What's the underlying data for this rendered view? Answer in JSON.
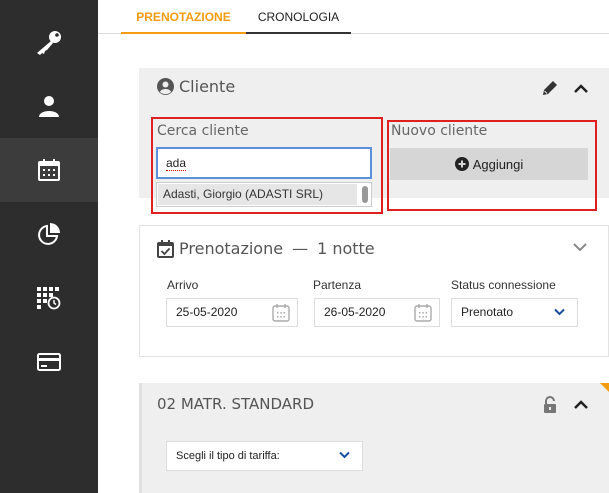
{
  "sidebar": {
    "items": [
      {
        "icon": "key-icon"
      },
      {
        "icon": "user-icon"
      },
      {
        "icon": "calendar-icon",
        "active": true
      },
      {
        "icon": "pie-chart-icon"
      },
      {
        "icon": "calendar-grid-clock-icon"
      },
      {
        "icon": "credit-card-icon"
      }
    ]
  },
  "tabs": [
    {
      "label": "PRENOTAZIONE",
      "active": true
    },
    {
      "label": "CRONOLOGIA",
      "active": false
    }
  ],
  "cliente": {
    "title": "Cliente",
    "search_label": "Cerca cliente",
    "search_value": "ada",
    "suggestion": "Adasti, Giorgio (ADASTI SRL)",
    "new_label": "Nuovo cliente",
    "add_button": "Aggiungi"
  },
  "prenotazione": {
    "title": "Prenotazione",
    "separator": "—",
    "nights": "1 notte",
    "arrivo_label": "Arrivo",
    "arrivo_value": "25-05-2020",
    "partenza_label": "Partenza",
    "partenza_value": "26-05-2020",
    "status_label": "Status connessione",
    "status_value": "Prenotato"
  },
  "room": {
    "title": "02 MATR. STANDARD",
    "tariff_select": "Scegli il tipo di tariffa:"
  },
  "colors": {
    "accent": "#f39c12",
    "sidebar_bg": "#2d2d2d",
    "highlight_box": "#e02020",
    "input_focus": "#5b8fd9"
  }
}
